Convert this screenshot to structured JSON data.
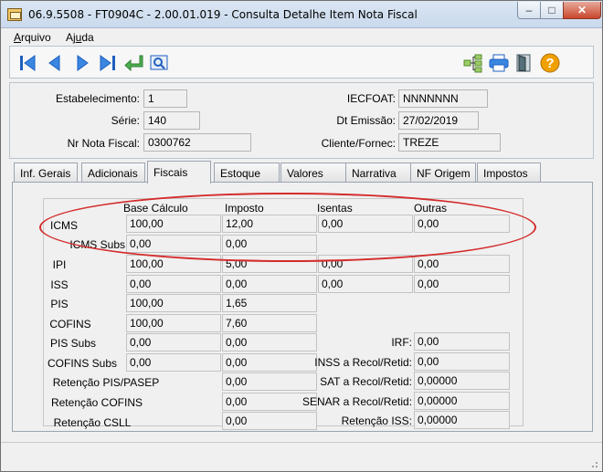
{
  "window": {
    "title": "06.9.5508 - FT0904C - 2.00.01.019 - Consulta Detalhe Item Nota Fiscal",
    "min_glyph": "–",
    "max_glyph": "□",
    "close_glyph": "✕"
  },
  "menu": {
    "arquivo_first": "A",
    "arquivo_rest": "rquivo",
    "ajuda_first": "Aj",
    "ajuda_ul": "u",
    "ajuda_rest": "da"
  },
  "toolbar": {
    "icons": [
      "first-record-icon",
      "previous-record-icon",
      "next-record-icon",
      "last-record-icon",
      "return-icon",
      "zoom-icon",
      "tree-icon",
      "print-icon",
      "exit-door-icon",
      "help-icon"
    ],
    "help_glyph": "?"
  },
  "header": {
    "estabelecimento_label": "Estabelecimento:",
    "estabelecimento_value": "1",
    "serie_label": "Série:",
    "serie_value": "140",
    "nr_nota_label": "Nr Nota Fiscal:",
    "nr_nota_value": "0300762",
    "iecfoat_label": "IECFOAT:",
    "iecfoat_value": "NNNNNNN",
    "dt_emissao_label": "Dt Emissão:",
    "dt_emissao_value": "27/02/2019",
    "cliente_label": "Cliente/Fornec:",
    "cliente_value": "TREZE"
  },
  "tabs": [
    "Inf. Gerais",
    "Adicionais",
    "Fiscais",
    "Estoque",
    "Valores",
    "Narrativa",
    "NF Origem",
    "Impostos"
  ],
  "active_tab": "Fiscais",
  "fiscais": {
    "columns": {
      "base": "Base Cálculo",
      "imposto": "Imposto",
      "isentas": "Isentas",
      "outras": "Outras"
    },
    "rows": {
      "icms": {
        "label": "ICMS",
        "base": "100,00",
        "imposto": "12,00",
        "isentas": "0,00",
        "outras": "0,00"
      },
      "icms_subs": {
        "label": "ICMS Subs",
        "base": "0,00",
        "imposto": "0,00"
      },
      "ipi": {
        "label": "IPI",
        "base": "100,00",
        "imposto": "5,00",
        "isentas": "0,00",
        "outras": "0,00"
      },
      "iss": {
        "label": "ISS",
        "base": "0,00",
        "imposto": "0,00",
        "isentas": "0,00",
        "outras": "0,00"
      },
      "pis": {
        "label": "PIS",
        "base": "100,00",
        "imposto": "1,65"
      },
      "cofins": {
        "label": "COFINS",
        "base": "100,00",
        "imposto": "7,60"
      },
      "pis_subs": {
        "label": "PIS Subs",
        "base": "0,00",
        "imposto": "0,00"
      },
      "cofins_subs": {
        "label": "COFINS Subs",
        "base": "0,00",
        "imposto": "0,00"
      },
      "ret_pis_pasep": {
        "label": "Retenção PIS/PASEP",
        "imposto": "0,00"
      },
      "ret_cofins": {
        "label": "Retenção COFINS",
        "imposto": "0,00"
      },
      "ret_csll": {
        "label": "Retenção CSLL",
        "imposto": "0,00"
      }
    },
    "right": {
      "irf": {
        "label": "IRF:",
        "value": "0,00"
      },
      "inss": {
        "label": "INSS a Recol/Retid:",
        "value": "0,00"
      },
      "sat": {
        "label": "SAT a Recol/Retid:",
        "value": "0,00000"
      },
      "senar": {
        "label": "SENAR a Recol/Retid:",
        "value": "0,00000"
      },
      "ret_iss": {
        "label": "Retenção ISS:",
        "value": "0,00000"
      }
    }
  },
  "colors": {
    "highlight": "#d42b2b",
    "toolbar_blue": "#1f5fbf",
    "help_orange": "#f0a000"
  }
}
